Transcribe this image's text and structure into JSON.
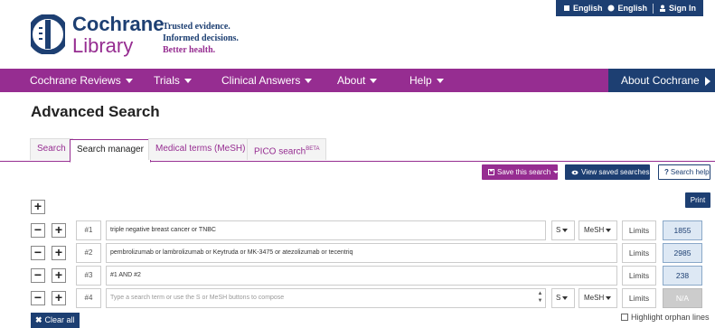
{
  "header": {
    "logo_line1": "Cochrane",
    "logo_line2": "Library",
    "tagline": [
      "Trusted evidence.",
      "Informed decisions.",
      "Better health."
    ],
    "topbar": {
      "lang1": "English",
      "lang2": "English",
      "signin": "Sign In"
    }
  },
  "nav": {
    "items": [
      "Cochrane Reviews",
      "Trials",
      "Clinical Answers",
      "About",
      "Help"
    ],
    "about_cochrane": "About Cochrane"
  },
  "page_title": "Advanced Search",
  "tabs": [
    {
      "label": "Search",
      "active": false
    },
    {
      "label": "Search manager",
      "active": true
    },
    {
      "label": "Medical terms (MeSH)",
      "active": false
    },
    {
      "label": "PICO search",
      "sup": "BETA",
      "active": false
    }
  ],
  "actions": {
    "save": "Save this search",
    "view_saved": "View saved searches",
    "help": "Search help",
    "print": "Print"
  },
  "rows": [
    {
      "num": "#1",
      "query": "triple negative breast cancer or TNBC",
      "s": "S",
      "mesh": "MeSH",
      "limits": "Limits",
      "result": "1855"
    },
    {
      "num": "#2",
      "query": "pembrolizumab or lambrolizumab or Keytruda or MK-3475 or atezolizumab or tecentriq",
      "limits": "Limits",
      "result": "2985"
    },
    {
      "num": "#3",
      "query": "#1 AND #2",
      "limits": "Limits",
      "result": "238"
    },
    {
      "num": "#4",
      "placeholder": "Type a search term or use the S or MeSH buttons to compose",
      "s": "S",
      "mesh": "MeSH",
      "limits": "Limits",
      "result": "N/A"
    }
  ],
  "clear_all": "Clear all",
  "highlight_orphan": "Highlight orphan lines",
  "colors": {
    "brand_purple": "#962d91",
    "brand_navy": "#1d3f72",
    "result_bg": "#dde8f4"
  },
  "icons": [
    "cochrane-logo-icon",
    "flag-icon",
    "globe-icon",
    "user-icon",
    "save-icon",
    "eye-icon",
    "question-icon",
    "close-icon",
    "checkbox-icon"
  ]
}
